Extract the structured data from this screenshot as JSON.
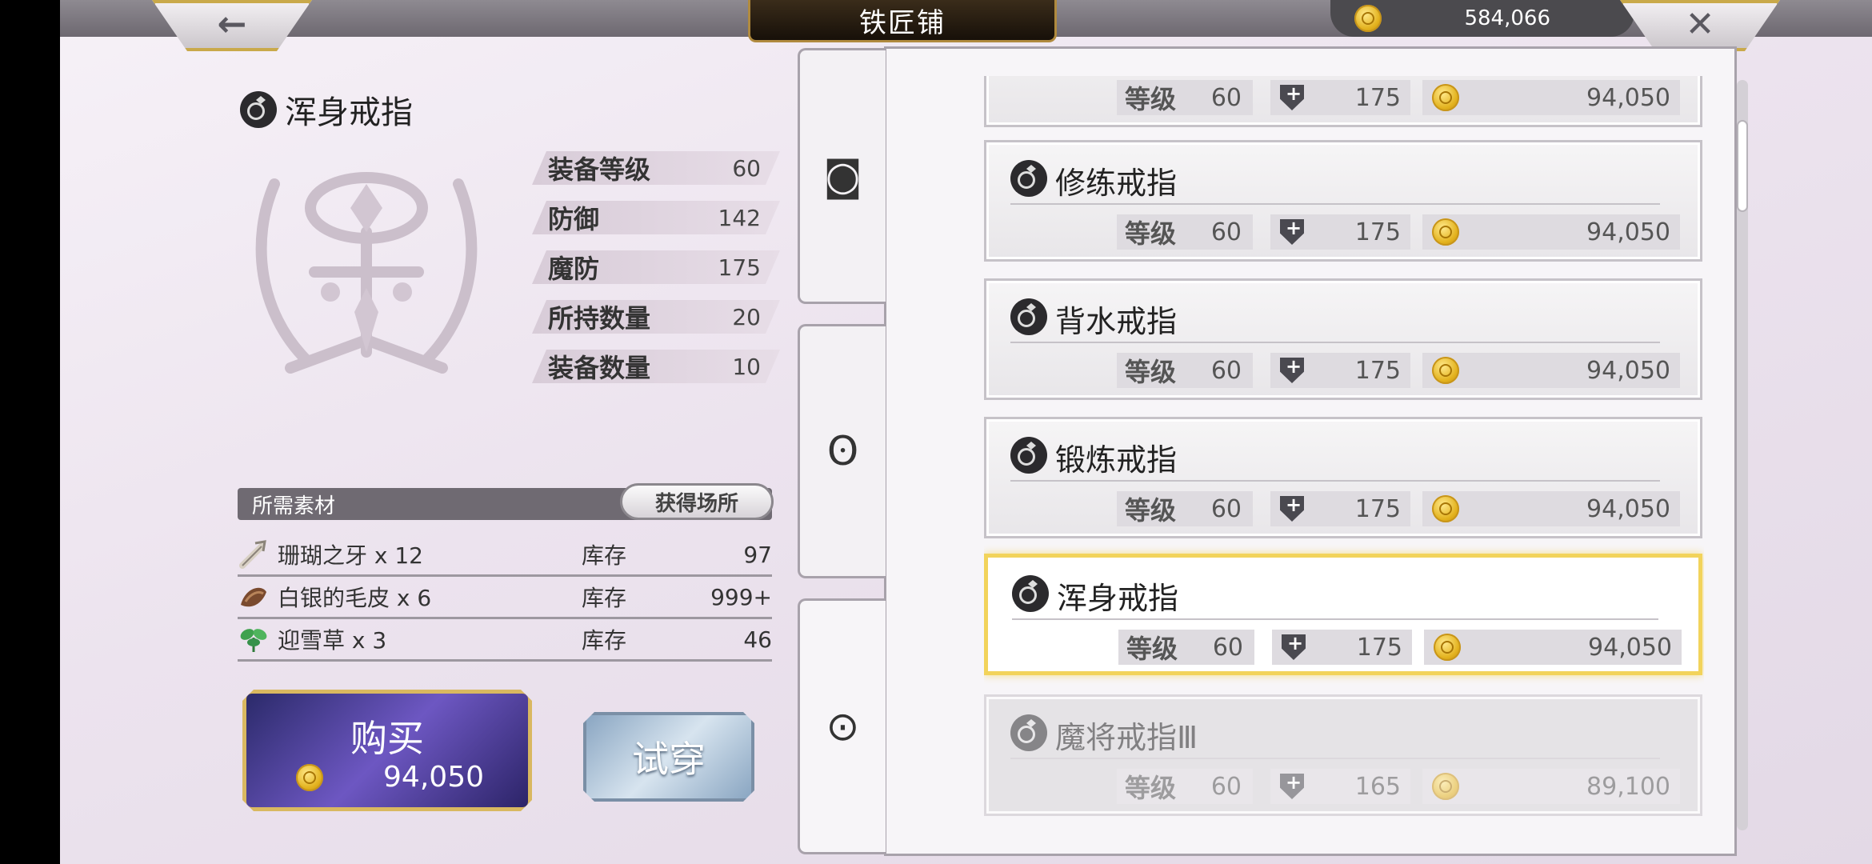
{
  "header": {
    "title": "铁匠铺",
    "currency": "584,066",
    "back_icon": "←",
    "close_icon": "✕"
  },
  "item": {
    "name": "浑身戒指",
    "stats": [
      {
        "label": "装备等级",
        "value": "60"
      },
      {
        "label": "防御",
        "value": "142"
      },
      {
        "label": "魔防",
        "value": "175"
      },
      {
        "label": "所持数量",
        "value": "20"
      },
      {
        "label": "装备数量",
        "value": "10"
      }
    ]
  },
  "materials": {
    "header": "所需素材",
    "obtain_label": "获得场所",
    "stock_label": "库存",
    "items": [
      {
        "name": "珊瑚之牙 x 12",
        "stock": "97",
        "icon": "bone-icon"
      },
      {
        "name": "白银的毛皮 x 6",
        "stock": "999+",
        "icon": "fur-icon"
      },
      {
        "name": "迎雪草 x 3",
        "stock": "46",
        "icon": "herb-icon"
      }
    ]
  },
  "actions": {
    "buy_label": "购买",
    "buy_price": "94,050",
    "try_label": "试穿"
  },
  "tabs": [
    {
      "icon": "bracer-icon",
      "glyph": "◙"
    },
    {
      "icon": "necklace-icon",
      "glyph": "ʘ"
    },
    {
      "icon": "ring-icon",
      "glyph": "⊙"
    }
  ],
  "list": {
    "level_label": "等级",
    "items": [
      {
        "name": "",
        "level": "60",
        "defense": "175",
        "price": "94,050",
        "state": "partial"
      },
      {
        "name": "修练戒指",
        "level": "60",
        "defense": "175",
        "price": "94,050",
        "state": "normal"
      },
      {
        "name": "背水戒指",
        "level": "60",
        "defense": "175",
        "price": "94,050",
        "state": "normal"
      },
      {
        "name": "锻炼戒指",
        "level": "60",
        "defense": "175",
        "price": "94,050",
        "state": "normal"
      },
      {
        "name": "浑身戒指",
        "level": "60",
        "defense": "175",
        "price": "94,050",
        "state": "selected"
      },
      {
        "name": "魔将戒指Ⅲ",
        "level": "60",
        "defense": "165",
        "price": "89,100",
        "state": "dim"
      }
    ]
  }
}
